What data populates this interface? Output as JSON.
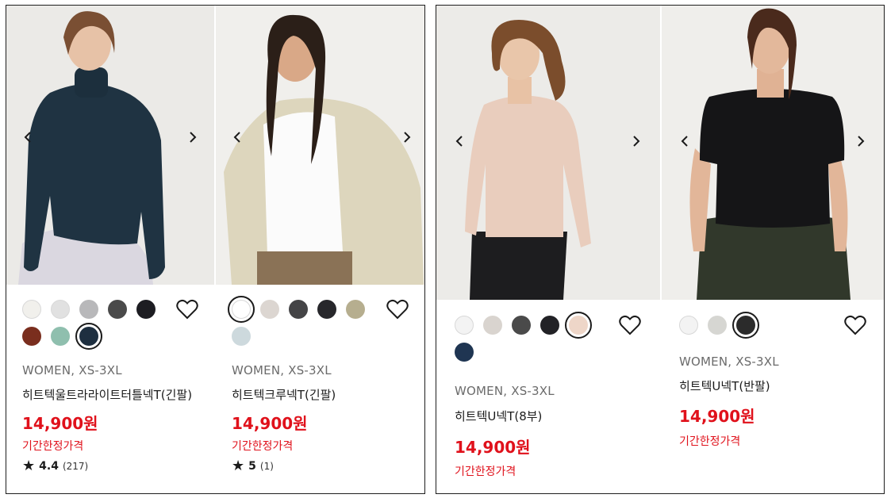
{
  "products": [
    {
      "category": "WOMEN, XS-3XL",
      "name": "히트텍울트라라이트터틀넥T(긴팔)",
      "price": "14,900원",
      "promo": "기간한정가격",
      "rating": {
        "star": "★",
        "score": "4.4",
        "count": "(217)"
      },
      "colors": [
        "#f1f0ec",
        "#e1e1e1",
        "#b8b8ba",
        "#4a4a4a",
        "#1d1d22",
        "#7a2e1e",
        "#8fbfae",
        "#1e2f40"
      ],
      "selected_color": 7
    },
    {
      "category": "WOMEN, XS-3XL",
      "name": "히트텍크루넥T(긴팔)",
      "price": "14,900원",
      "promo": "기간한정가격",
      "rating": {
        "star": "★",
        "score": "5",
        "count": "(1)"
      },
      "colors": [
        "#ffffff",
        "#dcd6d1",
        "#444446",
        "#27272b",
        "#b6ae8f",
        "#cdd9dd"
      ],
      "selected_color": 0
    },
    {
      "category": "WOMEN, XS-3XL",
      "name": "히트텍U넥T(8부)",
      "price": "14,900원",
      "promo": "기간한정가격",
      "colors": [
        "#f3f3f3",
        "#d9d4cf",
        "#4a4a4a",
        "#222226",
        "#eed6c8",
        "#1f3552"
      ],
      "selected_color": 4
    },
    {
      "category": "WOMEN, XS-3XL",
      "name": "히트텍U넥T(반팔)",
      "price": "14,900원",
      "promo": "기간한정가격",
      "colors": [
        "#f3f3f3",
        "#d6d6d2",
        "#2b2b2b"
      ],
      "selected_color": 2
    }
  ],
  "icons": {
    "prev": "chevron-left-icon",
    "next": "chevron-right-icon",
    "wishlist": "heart-outline-icon",
    "rating": "star-icon"
  }
}
